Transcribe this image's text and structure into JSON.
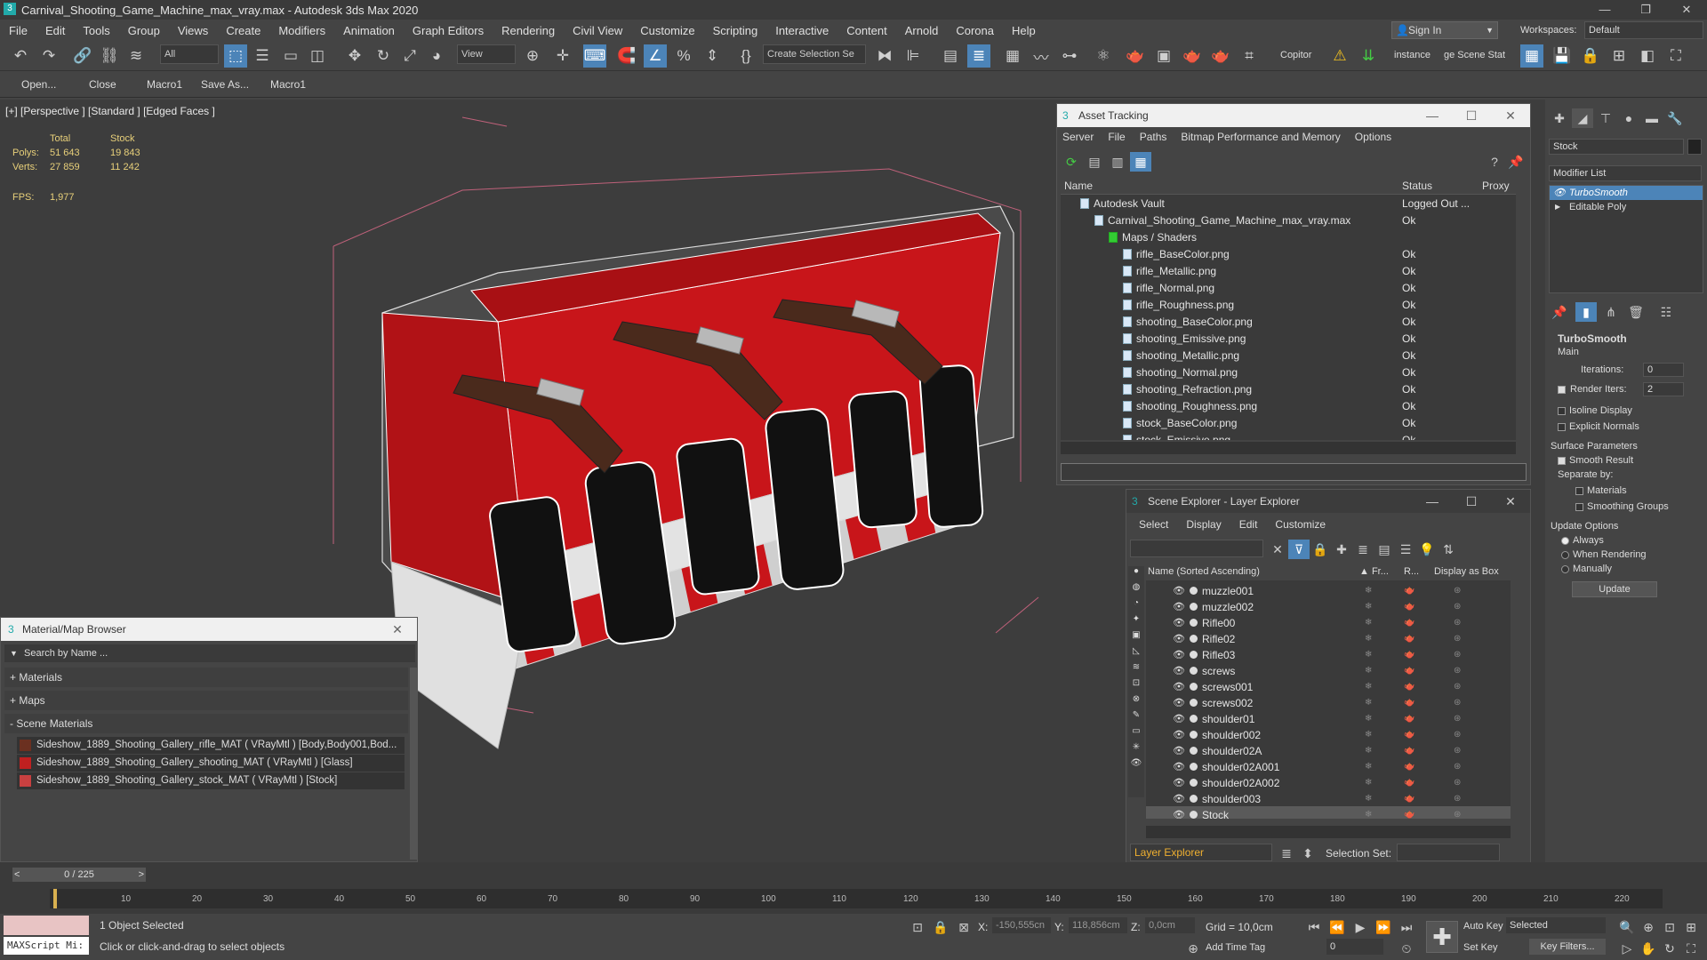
{
  "window": {
    "title": "Carnival_Shooting_Game_Machine_max_vray.max - Autodesk 3ds Max 2020",
    "min": "—",
    "max": "❐",
    "close": "✕"
  },
  "menu": [
    "File",
    "Edit",
    "Tools",
    "Group",
    "Views",
    "Create",
    "Modifiers",
    "Animation",
    "Graph Editors",
    "Rendering",
    "Civil View",
    "Customize",
    "Scripting",
    "Interactive",
    "Content",
    "Arnold",
    "Corona",
    "Help"
  ],
  "signin": "Sign In",
  "workspaces_label": "Workspaces:",
  "workspace": "Default",
  "toolbar": {
    "filter": "All",
    "view": "View",
    "selection_set": "Create Selection Se",
    "copitor": "Copitor",
    "instance": "instance",
    "scene_stat": "ge Scene Stat"
  },
  "subbar": {
    "open": "Open...",
    "close": "Close",
    "macro1": "Macro1",
    "saveas": "Save As...",
    "macro1b": "Macro1"
  },
  "viewport": {
    "label": "[+] [Perspective ] [Standard ] [Edged Faces ]",
    "total_h": "Total",
    "stock_h": "Stock",
    "polys_l": "Polys:",
    "polys_total": "51 643",
    "polys_stock": "19 843",
    "verts_l": "Verts:",
    "verts_total": "27 859",
    "verts_stock": "11 242",
    "fps_l": "FPS:",
    "fps": "1,977"
  },
  "asset": {
    "title": "Asset Tracking",
    "menus": [
      "Server",
      "File",
      "Paths",
      "Bitmap Performance and Memory",
      "Options"
    ],
    "cols": [
      "Name",
      "Status",
      "Proxy"
    ],
    "rows": [
      {
        "name": "Autodesk Vault",
        "status": "Logged Out ..."
      },
      {
        "name": "Carnival_Shooting_Game_Machine_max_vray.max",
        "status": "Ok"
      },
      {
        "name": "Maps / Shaders",
        "status": ""
      },
      {
        "name": "rifle_BaseColor.png",
        "status": "Ok"
      },
      {
        "name": "rifle_Metallic.png",
        "status": "Ok"
      },
      {
        "name": "rifle_Normal.png",
        "status": "Ok"
      },
      {
        "name": "rifle_Roughness.png",
        "status": "Ok"
      },
      {
        "name": "shooting_BaseColor.png",
        "status": "Ok"
      },
      {
        "name": "shooting_Emissive.png",
        "status": "Ok"
      },
      {
        "name": "shooting_Metallic.png",
        "status": "Ok"
      },
      {
        "name": "shooting_Normal.png",
        "status": "Ok"
      },
      {
        "name": "shooting_Refraction.png",
        "status": "Ok"
      },
      {
        "name": "shooting_Roughness.png",
        "status": "Ok"
      },
      {
        "name": "stock_BaseColor.png",
        "status": "Ok"
      },
      {
        "name": "stock_Emissive.png",
        "status": "Ok"
      }
    ]
  },
  "explorer": {
    "title": "Scene Explorer - Layer Explorer",
    "menus": [
      "Select",
      "Display",
      "Edit",
      "Customize"
    ],
    "col_name": "Name (Sorted Ascending)",
    "col_fr": "▲ Fr...",
    "col_r": "R...",
    "col_box": "Display as Box",
    "rows": [
      "muzzle001",
      "muzzle002",
      "Rifle00",
      "Rifle02",
      "Rifle03",
      "screws",
      "screws001",
      "screws002",
      "shoulder01",
      "shoulder002",
      "shoulder02A",
      "shoulder02A001",
      "shoulder02A002",
      "shoulder003",
      "Stock"
    ],
    "footer_layer": "Layer Explorer",
    "selection_set": "Selection Set:"
  },
  "matbrowser": {
    "title": "Material/Map Browser",
    "search": "Search by Name ...",
    "materials": "+ Materials",
    "maps": "+ Maps",
    "scene": "- Scene Materials",
    "items": [
      "Sideshow_1889_Shooting_Gallery_rifle_MAT ( VRayMtl ) [Body,Body001,Bod...",
      "Sideshow_1889_Shooting_Gallery_shooting_MAT ( VRayMtl ) [Glass]",
      "Sideshow_1889_Shooting_Gallery_stock_MAT ( VRayMtl ) [Stock]"
    ]
  },
  "cmd": {
    "name": "Stock",
    "modlist": "Modifier List",
    "mods": [
      "TurboSmooth",
      "Editable Poly"
    ],
    "ts": "TurboSmooth",
    "main": "Main",
    "iter_l": "Iterations:",
    "iter": "0",
    "render_l": "Render Iters:",
    "render": "2",
    "isoline": "Isoline Display",
    "explicit": "Explicit Normals",
    "surface": "Surface Parameters",
    "smooth": "Smooth Result",
    "sepby": "Separate by:",
    "mats": "Materials",
    "sgroups": "Smoothing Groups",
    "update_opts": "Update Options",
    "always": "Always",
    "whenr": "When Rendering",
    "manually": "Manually",
    "update": "Update"
  },
  "timeline": {
    "frame": "0 / 225",
    "ticks": [
      "10",
      "20",
      "30",
      "40",
      "50",
      "60",
      "70",
      "80",
      "90",
      "100",
      "110",
      "120",
      "130",
      "140",
      "150",
      "160",
      "170",
      "180",
      "190",
      "200",
      "210",
      "220"
    ]
  },
  "status": {
    "maxscript": "MAXScript Mi:",
    "selected": "1 Object Selected",
    "hint": "Click or click-and-drag to select objects",
    "x_l": "X:",
    "x": "-150,555cn",
    "y_l": "Y:",
    "y": "118,856cm",
    "z_l": "Z:",
    "z": "0,0cm",
    "grid": "Grid = 10,0cm",
    "addtime": "Add Time Tag",
    "autokey": "Auto Key",
    "selected_dd": "Selected",
    "setkey": "Set Key",
    "keyfilters": "Key Filters...",
    "frame": "0"
  }
}
